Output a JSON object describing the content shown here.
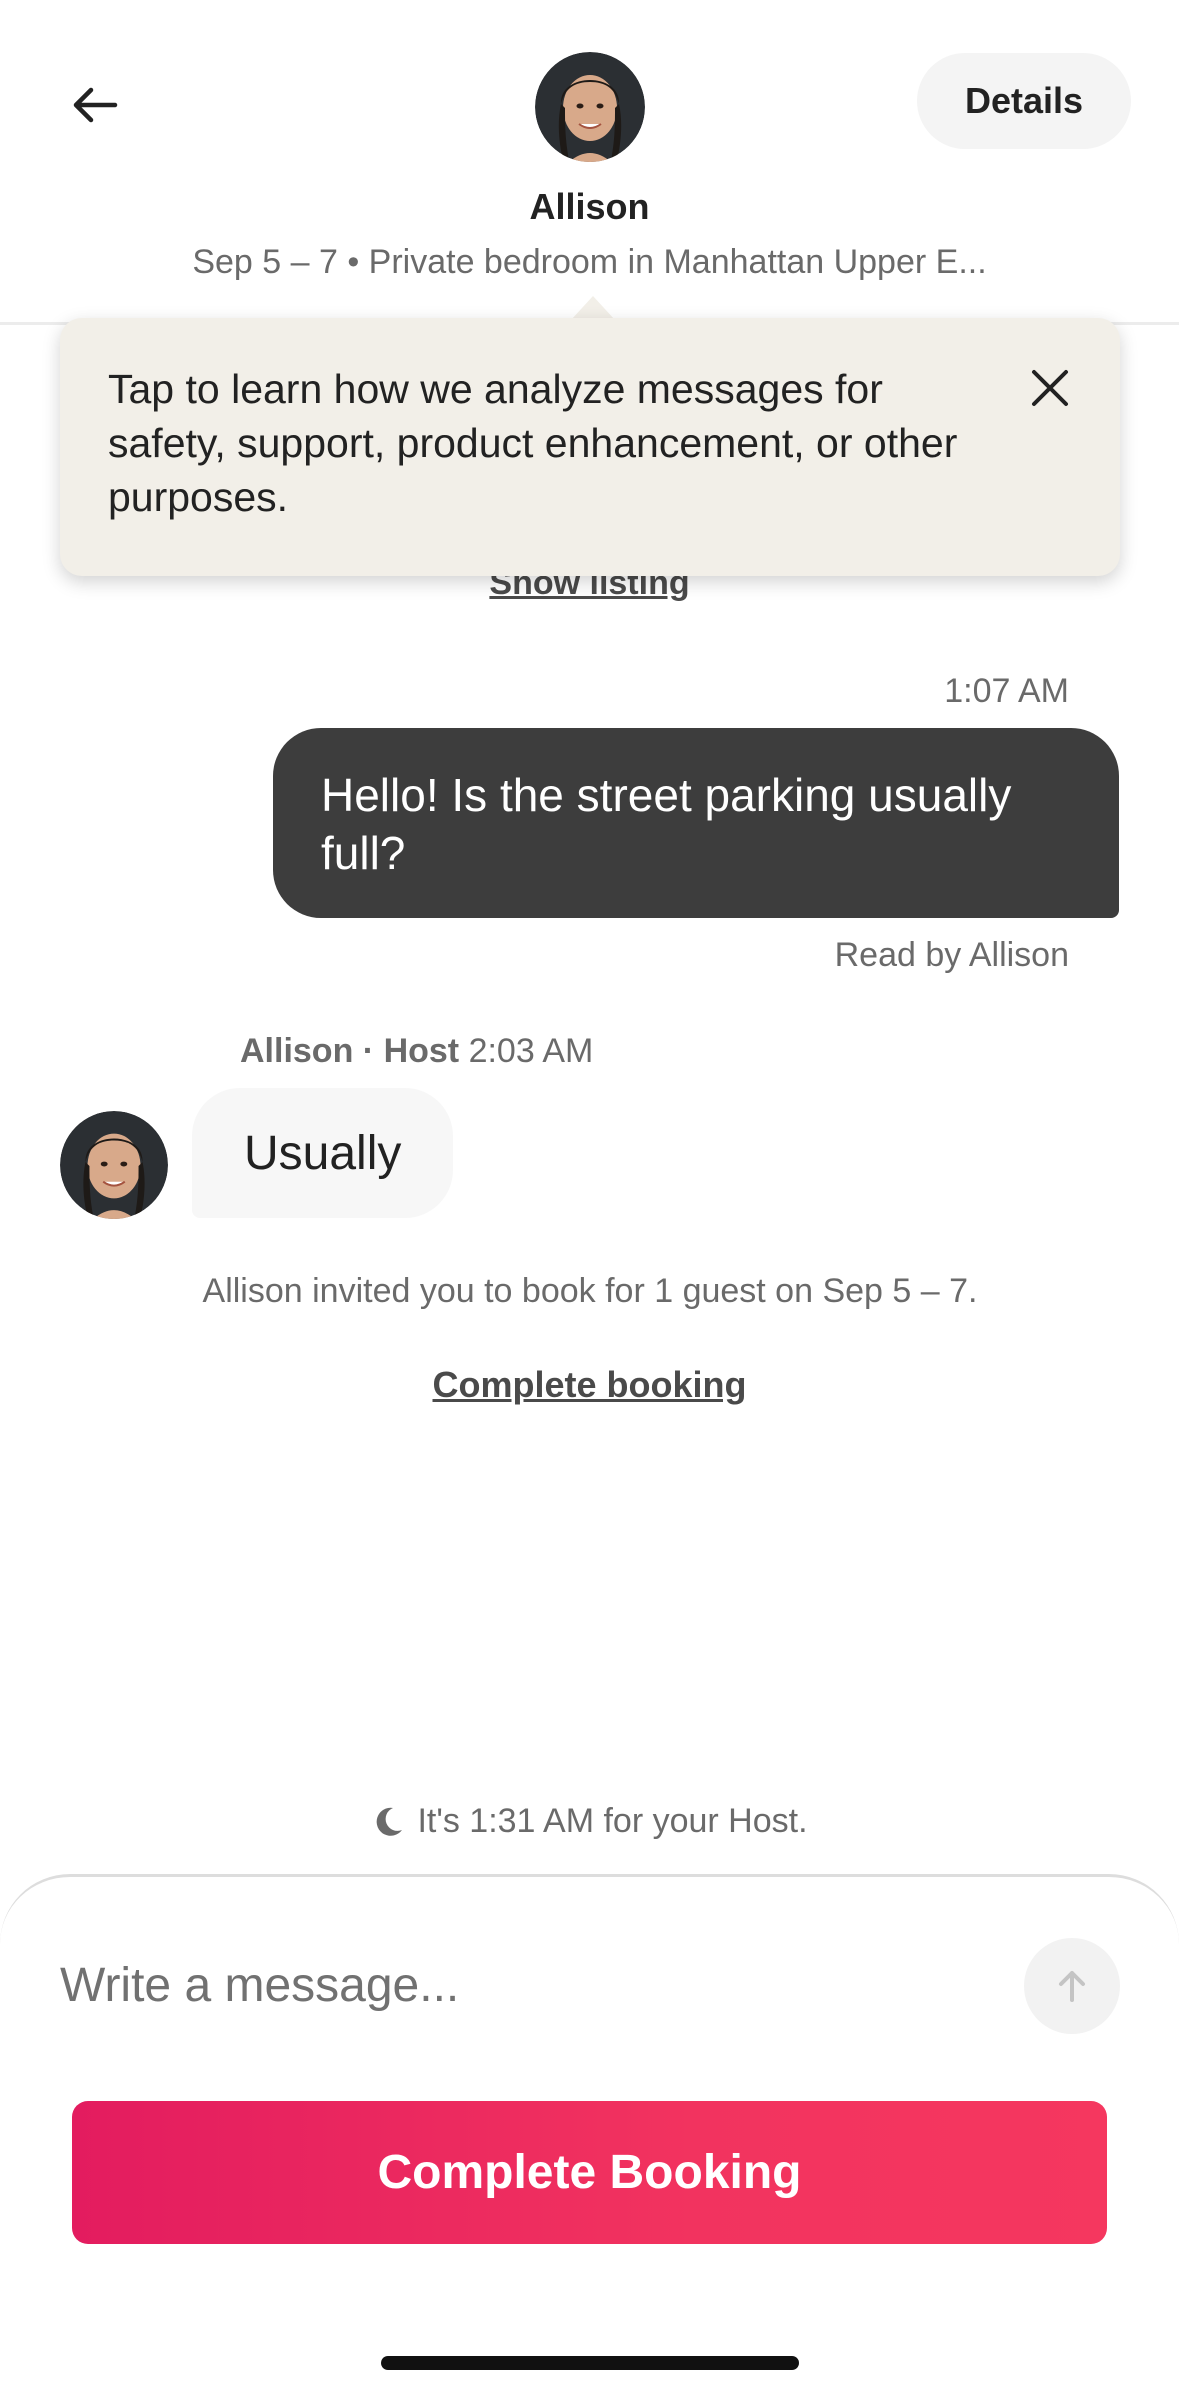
{
  "header": {
    "back_icon": "arrow-left-icon",
    "host_name": "Allison",
    "details_label": "Details",
    "listing_subtitle": "Sep 5 – 7 • Private bedroom in Manhattan Upper E..."
  },
  "tooltip": {
    "text": "Tap to learn how we analyze messages for safety, support, product enhancement, or other purposes.",
    "close_icon": "close-icon"
  },
  "thread": {
    "show_listing_label": "Show listing",
    "outgoing": {
      "timestamp": "1:07 AM",
      "text": "Hello! Is the street parking usually full?",
      "read_receipt": "Read by Allison"
    },
    "incoming": {
      "sender": "Allison",
      "role_prefix": " · ",
      "role": "Host",
      "timestamp": " 2:03 AM",
      "text": "Usually"
    },
    "invite": {
      "text": "Allison invited you to book for 1 guest on Sep 5 – 7.",
      "link_label": "Complete booking"
    },
    "host_time": {
      "icon": "moon-icon",
      "text": "It's 1:31 AM for your Host."
    }
  },
  "composer": {
    "placeholder": "Write a message...",
    "send_icon": "arrow-up-icon",
    "book_button_label": "Complete Booking"
  },
  "colors": {
    "brand": "#e31c5f",
    "outgoing_bubble": "#3d3d3d",
    "incoming_bubble": "#f7f7f7",
    "tooltip_bg": "#f2efe8"
  }
}
